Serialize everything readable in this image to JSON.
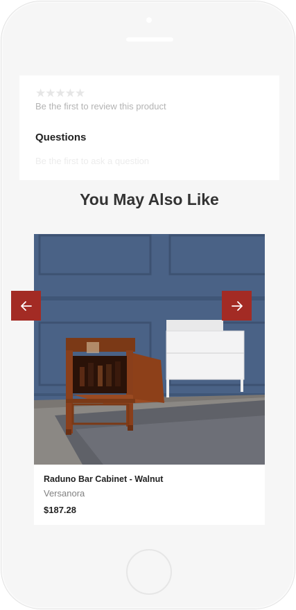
{
  "reviews": {
    "stars": "★★★★★",
    "empty_text": "Be the first to review this product"
  },
  "questions": {
    "title": "Questions",
    "empty_text": "Be the first to ask a question"
  },
  "recommendations": {
    "title": "You May Also Like",
    "product": {
      "name": "Raduno Bar Cabinet - Walnut",
      "brand": "Versanora",
      "price": "$187.28"
    }
  },
  "icons": {
    "prev": "arrow-left-icon",
    "next": "arrow-right-icon"
  },
  "colors": {
    "accent": "#a32b24",
    "wall": "#486082",
    "walnut": "#8a3f1b"
  }
}
